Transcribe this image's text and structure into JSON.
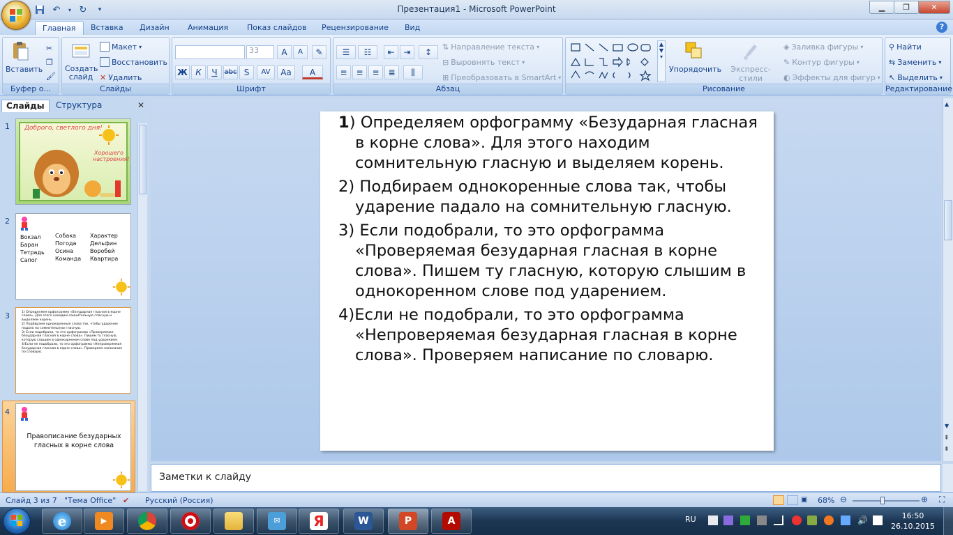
{
  "window": {
    "title": "Презентация1 - Microsoft PowerPoint"
  },
  "tabs": [
    "Главная",
    "Вставка",
    "Дизайн",
    "Анимация",
    "Показ слайдов",
    "Рецензирование",
    "Вид"
  ],
  "ribbon": {
    "clipboard": {
      "paste": "Вставить",
      "label": "Буфер о..."
    },
    "slides": {
      "new_slide": "Создать слайд",
      "layout": "Макет",
      "reset": "Восстановить",
      "delete": "Удалить",
      "label": "Слайды"
    },
    "font": {
      "size": "33",
      "label": "Шрифт"
    },
    "paragraph": {
      "direction": "Направление текста",
      "align": "Выровнять текст",
      "smartart": "Преобразовать в SmartArt",
      "label": "Абзац"
    },
    "drawing": {
      "arrange": "Упорядочить",
      "quickstyles": "Экспресс-стили",
      "fill": "Заливка фигуры",
      "outline": "Контур фигуры",
      "effects": "Эффекты для фигур",
      "label": "Рисование"
    },
    "editing": {
      "find": "Найти",
      "replace": "Заменить",
      "select": "Выделить",
      "label": "Редактирование"
    }
  },
  "pane": {
    "tab_slides": "Слайды",
    "tab_outline": "Структура"
  },
  "thumbs": {
    "n1": "1",
    "n2": "2",
    "n3": "3",
    "n4": "4",
    "t1_line1": "Доброго, светлого дня!",
    "t1_line2": "Хорошего настроения!",
    "t2_words": [
      "Вокзал",
      "Баран",
      "Тетрадь",
      "Сапог",
      "Собака",
      "Погода",
      "Осина",
      "Команда",
      "Характер",
      "Дельфин",
      "Воробей",
      "Квартира"
    ],
    "t3_text": [
      "1) Определяем орфограмму «Безударная гласная в корне слова». Для этого находим сомнительную гласную и выделяем корень.",
      "2) Подбираем однокоренные слова так, чтобы ударение падало на сомнительную гласную.",
      "3) Если подобрали, то это орфограмма «Проверяемая безударная гласная в корне слова». Пишем ту гласную, которую слышим в однокоренном слове под ударением.",
      "4)Если не подобрали, то это орфограмма «Непроверяемая безударная гласная в корне слова». Проверяем написание по словарю."
    ],
    "t4_text": "Правописание безударных гласных в корне слова"
  },
  "slide": {
    "p1_num": "1",
    "p1_rest": ") Определяем орфограмму «Безударная гласная в корне слова». Для этого находим сомнительную гласную и выделяем корень.",
    "p2": "2) Подбираем однокоренные слова так, чтобы ударение падало на сомнительную гласную.",
    "p3": "3) Если подобрали, то это орфограмма «Проверяемая безударная гласная в корне слова». Пишем ту гласную, которую слышим в однокоренном слове под ударением.",
    "p4": "4)Если не подобрали, то это орфограмма «Непроверяемая безударная гласная в корне слова». Проверяем написание по словарю."
  },
  "notes": {
    "placeholder": "Заметки к слайду"
  },
  "status": {
    "slide": "Слайд 3 из 7",
    "theme": "\"Тема Office\"",
    "lang": "Русский (Россия)",
    "zoom": "68%"
  },
  "taskbar": {
    "lang": "RU",
    "time": "16:50",
    "date": "26.10.2015"
  }
}
